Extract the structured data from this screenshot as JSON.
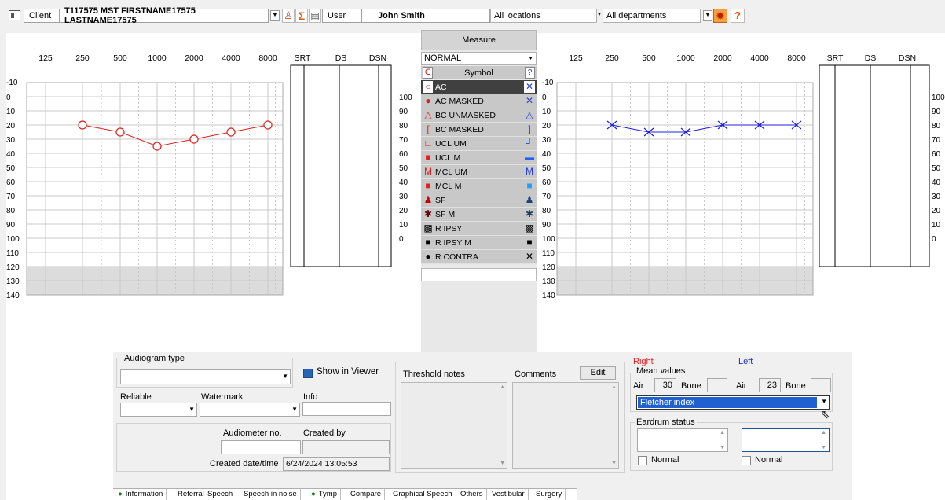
{
  "topbar": {
    "client_label": "Client",
    "client_name": "T117575 MST FIRSTNAME17575 LASTNAME17575",
    "user_label": "User",
    "user_name": "John Smith",
    "locations": "All locations",
    "departments": "All departments"
  },
  "measure": {
    "button": "Measure",
    "mode": "NORMAL",
    "symbol_header": "Symbol",
    "symbols": [
      "AC",
      "AC MASKED",
      "BC UNMASKED",
      "BC MASKED",
      "UCL UM",
      "UCL M",
      "MCL UM",
      "MCL M",
      "SF",
      "SF M",
      "R IPSY",
      "R IPSY M",
      "R CONTRA"
    ]
  },
  "audiogram": {
    "freq_labels": [
      "125",
      "250",
      "500",
      "1000",
      "2000",
      "4000",
      "8000"
    ],
    "speech_labels": [
      "SRT",
      "DS",
      "DSN"
    ],
    "db_labels": [
      "-10",
      "0",
      "10",
      "20",
      "30",
      "40",
      "50",
      "60",
      "70",
      "80",
      "90",
      "100",
      "110",
      "120",
      "130",
      "140"
    ],
    "pct_labels": [
      "100",
      "90",
      "80",
      "70",
      "60",
      "50",
      "40",
      "30",
      "20",
      "10",
      "0"
    ],
    "right_color": "#e02020",
    "left_color": "#2020e0"
  },
  "chart_data": [
    {
      "type": "line",
      "name": "right-ear-audiogram",
      "x": [
        250,
        500,
        1000,
        2000,
        4000,
        8000
      ],
      "series": [
        {
          "name": "AC",
          "values": [
            20,
            25,
            35,
            30,
            25,
            20
          ]
        }
      ],
      "ylim": [
        -10,
        140
      ],
      "y_inverted": true
    },
    {
      "type": "line",
      "name": "left-ear-audiogram",
      "x": [
        250,
        500,
        1000,
        2000,
        4000,
        8000
      ],
      "series": [
        {
          "name": "AC",
          "values": [
            20,
            25,
            25,
            20,
            20,
            20
          ]
        }
      ],
      "ylim": [
        -10,
        140
      ],
      "y_inverted": true
    }
  ],
  "bottom": {
    "audiogram_type_label": "Audiogram type",
    "show_in_viewer": "Show in Viewer",
    "reliable_label": "Reliable",
    "watermark_label": "Watermark",
    "info_label": "Info",
    "audiometer_label": "Audiometer no.",
    "created_by_label": "Created by",
    "created_dt_label": "Created date/time",
    "created_dt_value": "6/24/2024 13:05:53",
    "threshold_notes_label": "Threshold notes",
    "comments_label": "Comments",
    "edit_button": "Edit",
    "right_label": "Right",
    "left_label": "Left",
    "mean_values_label": "Mean values",
    "air_label": "Air",
    "bone_label": "Bone",
    "right_air_value": "30",
    "left_air_value": "23",
    "mean_method": "Fletcher index",
    "eardrum_label": "Eardrum status",
    "normal_label": "Normal"
  },
  "tabs": [
    "Information",
    "Referral",
    "Speech",
    "Speech in noise",
    "Tymp",
    "Compare",
    "Graphical Speech",
    "Others",
    "Vestibular",
    "Surgery"
  ]
}
